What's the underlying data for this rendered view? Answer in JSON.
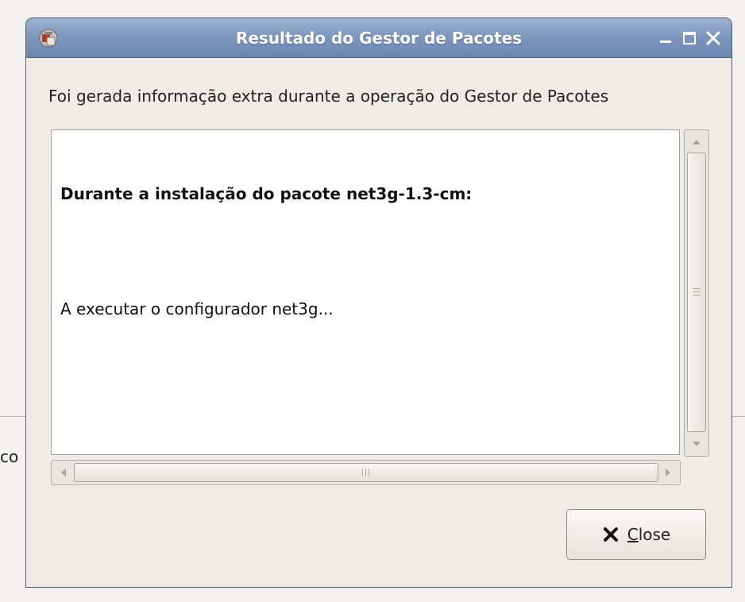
{
  "window": {
    "title": "Resultado do Gestor de Pacotes"
  },
  "background": {
    "partial_text": "co"
  },
  "dialog": {
    "message": "Foi gerada informação extra durante a operação do Gestor de Pacotes",
    "log": {
      "heading": "Durante a instalação do pacote net3g-1.3-cm:",
      "body": "A executar o configurador net3g..."
    }
  },
  "buttons": {
    "close": {
      "mnemonic": "C",
      "rest": "lose",
      "icon": "close-x-icon"
    }
  },
  "colors": {
    "titlebar": "#7e97bd",
    "window_bg": "#efebe7",
    "text_bg": "#ffffff"
  }
}
